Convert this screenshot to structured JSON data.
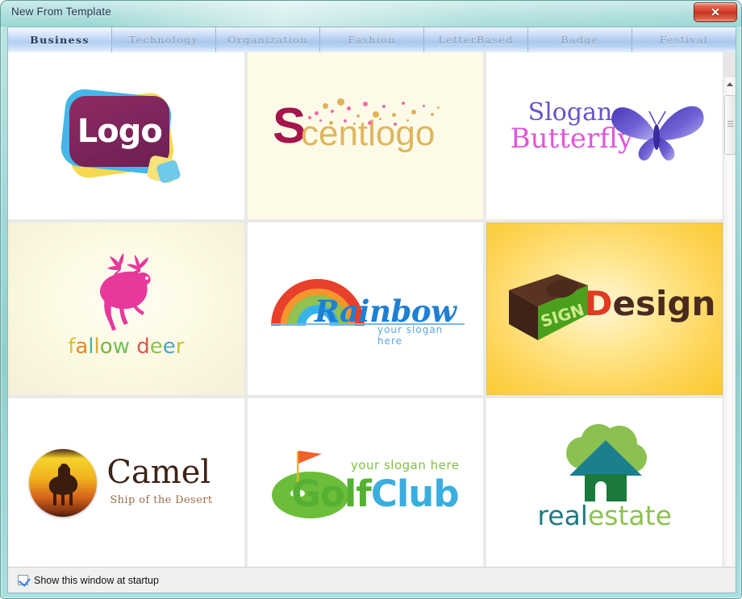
{
  "window": {
    "title": "New From Template",
    "close_label": "✕",
    "accent_frame": "#9fd8d6"
  },
  "tabs": {
    "items": [
      {
        "label": "Business",
        "active": true
      },
      {
        "label": "Technology",
        "active": false
      },
      {
        "label": "Organization",
        "active": false
      },
      {
        "label": "Fashion",
        "active": false
      },
      {
        "label": "LetterBased",
        "active": false
      },
      {
        "label": "Badge",
        "active": false
      },
      {
        "label": "Festival",
        "active": false
      }
    ]
  },
  "templates": [
    {
      "name": "Logo",
      "text": "Logo",
      "selected": false,
      "colors": {
        "main": "#7a2359",
        "yellow": "#f6d94f",
        "blue": "#43b7e8",
        "text": "#ffffff"
      }
    },
    {
      "name": "Scentlogo",
      "text_first": "S",
      "text_rest": "centlogo",
      "selected": false,
      "colors": {
        "first": "#a6144c",
        "rest": "#dfb65c",
        "dots_pink": "#f06aa8",
        "dots_gold": "#e0b257",
        "bg": "#fdfbe8"
      }
    },
    {
      "name": "Slogan Butterfly",
      "line1": "Slogan",
      "line2": "Butterfly",
      "selected": false,
      "colors": {
        "line1": "#6a52c9",
        "line2": "#e055d8",
        "butterfly": "#6457c8"
      }
    },
    {
      "name": "fallow deer",
      "text": "fallow deer",
      "letters": [
        {
          "ch": "f",
          "color": "#d9c32e"
        },
        {
          "ch": "a",
          "color": "#e08a2e"
        },
        {
          "ch": "l",
          "color": "#3fb8a0"
        },
        {
          "ch": "l",
          "color": "#e0a83a"
        },
        {
          "ch": "o",
          "color": "#7cb342"
        },
        {
          "ch": "w",
          "color": "#6fbf5a"
        },
        {
          "ch": " ",
          "color": "#ffffff"
        },
        {
          "ch": "d",
          "color": "#e0554f"
        },
        {
          "ch": "e",
          "color": "#8cc152"
        },
        {
          "ch": "e",
          "color": "#4aa8c4"
        },
        {
          "ch": "r",
          "color": "#c9c33a"
        }
      ],
      "selected": false,
      "colors": {
        "deer": "#e6399b",
        "bg": "#fdfae4"
      }
    },
    {
      "name": "Rainbow",
      "text": "Rainbow",
      "slogan": "your slogan here",
      "selected": false,
      "colors": {
        "text": "#1f7fd4",
        "slogan": "#5aa7e0",
        "arcs": [
          "#e8402a",
          "#f07d22",
          "#f6c game",
          "#8cc152",
          "#38b3e8"
        ]
      }
    },
    {
      "name": "SIGN Design",
      "box_text": "SIGN",
      "text_first": "D",
      "text_rest": "esign",
      "selected": true,
      "colors": {
        "box_face": "#5aa21e",
        "box_side": "#4a2a1e",
        "first": "#e03b20",
        "rest": "#4a2a1e",
        "bg": "#fdd456"
      }
    },
    {
      "name": "Camel",
      "text": "Camel",
      "tagline": "Ship of the Desert",
      "selected": false,
      "colors": {
        "text": "#3d2317",
        "tagline": "#9a7048",
        "badge_top": "#f5d32a",
        "badge_bottom": "#7a2d10"
      }
    },
    {
      "name": "GolfClub",
      "text_first": "Golf",
      "text_rest": "Club",
      "slogan": "your slogan here",
      "selected": false,
      "colors": {
        "first": "#55b034",
        "rest": "#3aaede",
        "slogan": "#7ec142",
        "flag": "#f0612a",
        "green": "#6cbe3a"
      }
    },
    {
      "name": "realestate",
      "text_first": "real",
      "text_rest": "estate",
      "selected": false,
      "colors": {
        "first": "#1f7a80",
        "rest": "#8cc152",
        "roof": "#1b7f8e",
        "house": "#1a7a3c",
        "bush": "#8cc152"
      }
    }
  ],
  "scrollbar": {
    "up_arrow": "▲",
    "down_arrow": "▼"
  },
  "footer": {
    "checkbox_label": "Show this window at startup",
    "checked": true
  }
}
